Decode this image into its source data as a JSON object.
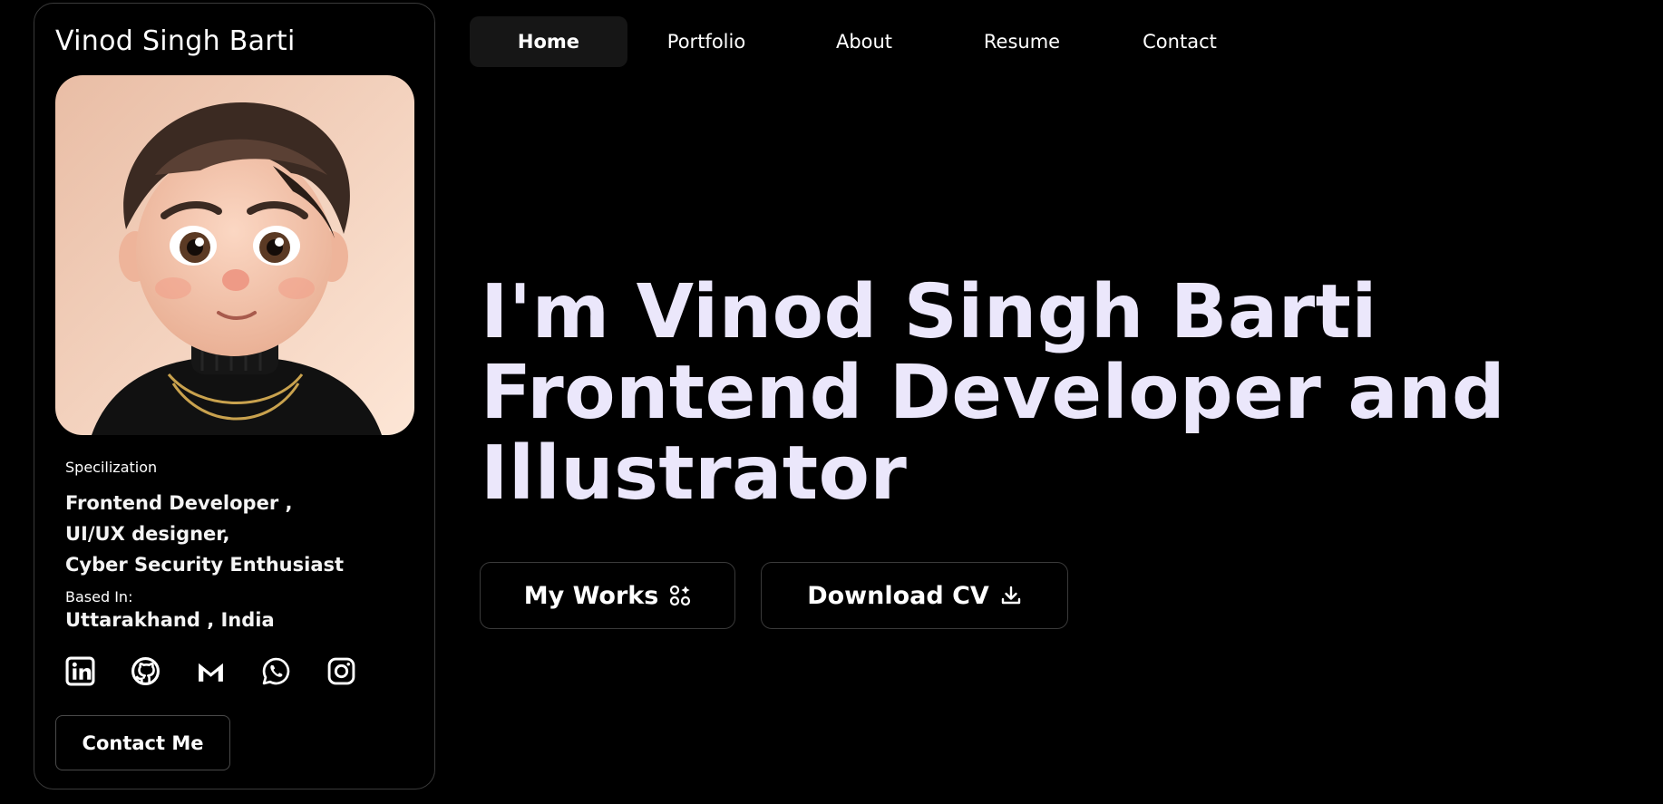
{
  "profile": {
    "name": "Vinod Singh Barti",
    "specialization_label": "Specilization",
    "specializations": [
      "Frontend Developer ,",
      "UI/UX designer,",
      "Cyber Security Enthusiast"
    ],
    "based_in_label": "Based In:",
    "location": "Uttarakhand , India",
    "socials": [
      "linkedin-icon",
      "github-icon",
      "gmail-icon",
      "whatsapp-icon",
      "instagram-icon"
    ],
    "contact_button": "Contact Me"
  },
  "nav": {
    "items": [
      "Home",
      "Portfolio",
      "About",
      "Resume",
      "Contact"
    ],
    "active": "Home"
  },
  "hero": {
    "lines": [
      "I'm Vinod Singh Barti",
      "Frontend Developer and",
      "Illustrator"
    ],
    "buttons": {
      "works": "My Works",
      "cv": "Download CV"
    }
  },
  "colors": {
    "background": "#000000",
    "hero_text": "#ebe7fb",
    "nav_active_bg": "#161616",
    "border": "#3a3a3a"
  }
}
